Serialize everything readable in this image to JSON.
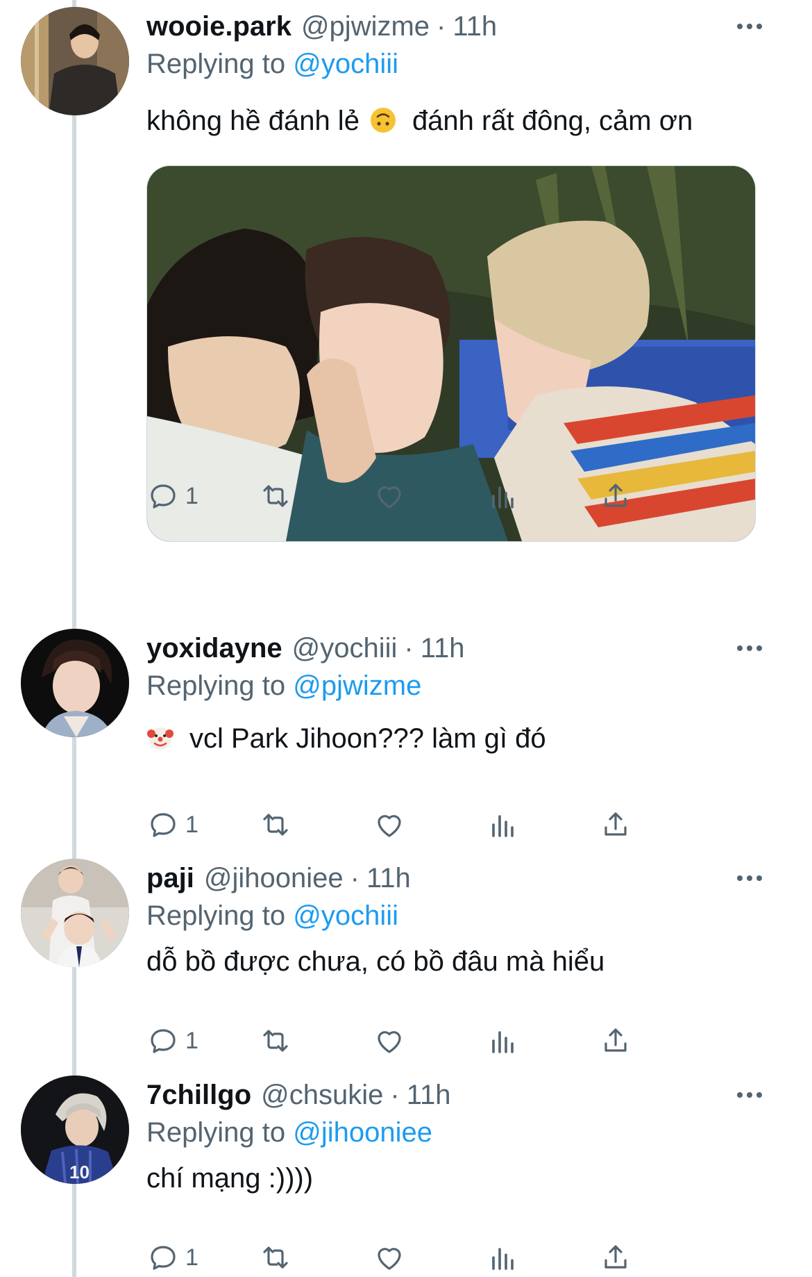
{
  "colors": {
    "accent": "#1d9bf0",
    "secondary_text": "#536471",
    "primary_text": "#0f1419",
    "thread_line": "#cfd9de"
  },
  "labels": {
    "replying_prefix": "Replying to"
  },
  "tweets": [
    {
      "display_name": "wooie.park",
      "handle": "@pjwizme",
      "separator": "·",
      "time": "11h",
      "replying_to": "@yochiii",
      "text_before_emoji": "không hề đánh lẻ",
      "emoji": "upside-down-face",
      "text_after_emoji": "đánh rất đông, cảm ơn",
      "has_media": true,
      "reply_count": "1",
      "icons": [
        "reply-icon",
        "retweet-icon",
        "like-icon",
        "analytics-icon",
        "share-icon"
      ]
    },
    {
      "display_name": "yoxidayne",
      "handle": "@yochiii",
      "separator": "·",
      "time": "11h",
      "replying_to": "@pjwizme",
      "emoji": "clown-face",
      "text": "vcl Park Jihoon??? làm gì đó",
      "has_media": false,
      "reply_count": "1"
    },
    {
      "display_name": "paji",
      "handle": "@jihooniee",
      "separator": "·",
      "time": "11h",
      "replying_to": "@yochiii",
      "text": "dỗ bồ được chưa, có bồ đâu mà hiểu",
      "has_media": false,
      "reply_count": "1"
    },
    {
      "display_name": "7chillgo",
      "handle": "@chsukie",
      "separator": "·",
      "time": "11h",
      "replying_to": "@jihooniee",
      "text": "chí mạng :))))",
      "has_media": false,
      "reply_count": "1"
    }
  ]
}
